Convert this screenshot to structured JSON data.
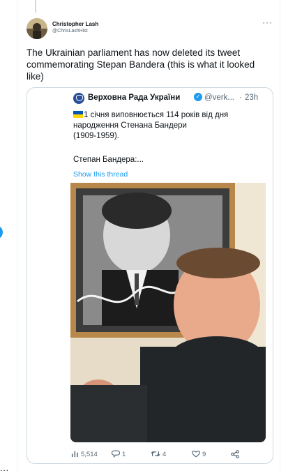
{
  "tweet": {
    "author": {
      "name": "Christopher Lash",
      "handle": "@ChrisLashHist"
    },
    "more_label": "···",
    "text": "The Ukrainian parliament has now deleted its tweet commemorating Stepan Bandera (this is what it looked like)"
  },
  "quoted": {
    "author_name": "Верховна Рада України",
    "verified_mark": "✓",
    "handle": "@verk...",
    "dot": "·",
    "time": "23h",
    "text_line": "1 січня виповнюється 114 років від дня народження Стенана Бандери",
    "years": "(1909-1959).",
    "more_text": "Степан Бандера:...",
    "show_thread": "Show this thread",
    "image": {
      "description_icon": "photo"
    }
  },
  "actions": {
    "views": "5,514",
    "replies": "1",
    "retweets": "4",
    "likes": "9"
  },
  "rail": {
    "dots": "..."
  },
  "colors": {
    "accent": "#1d9bf0",
    "muted": "#536471",
    "text": "#0f1419",
    "border": "#cfd9de"
  }
}
